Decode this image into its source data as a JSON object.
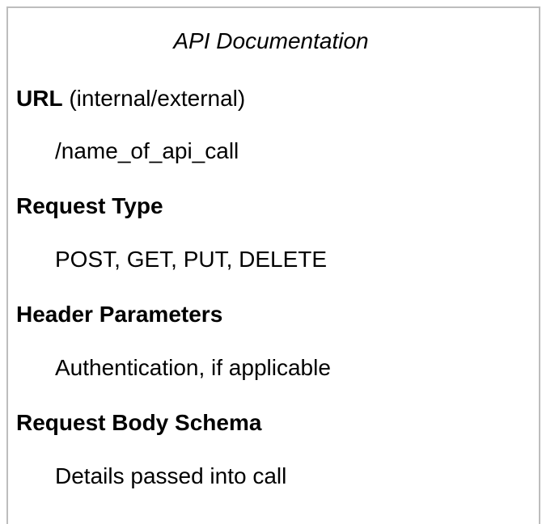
{
  "document": {
    "title": "API Documentation",
    "url_heading": "URL",
    "url_note": " (internal/external)",
    "url_value": "/name_of_api_call",
    "request_type_heading": "Request Type",
    "request_type_value": "POST, GET, PUT, DELETE",
    "header_params_heading": "Header Parameters",
    "header_params_value": "Authentication, if applicable",
    "request_body_heading": "Request Body Schema",
    "request_body_value": "Details passed into call"
  }
}
